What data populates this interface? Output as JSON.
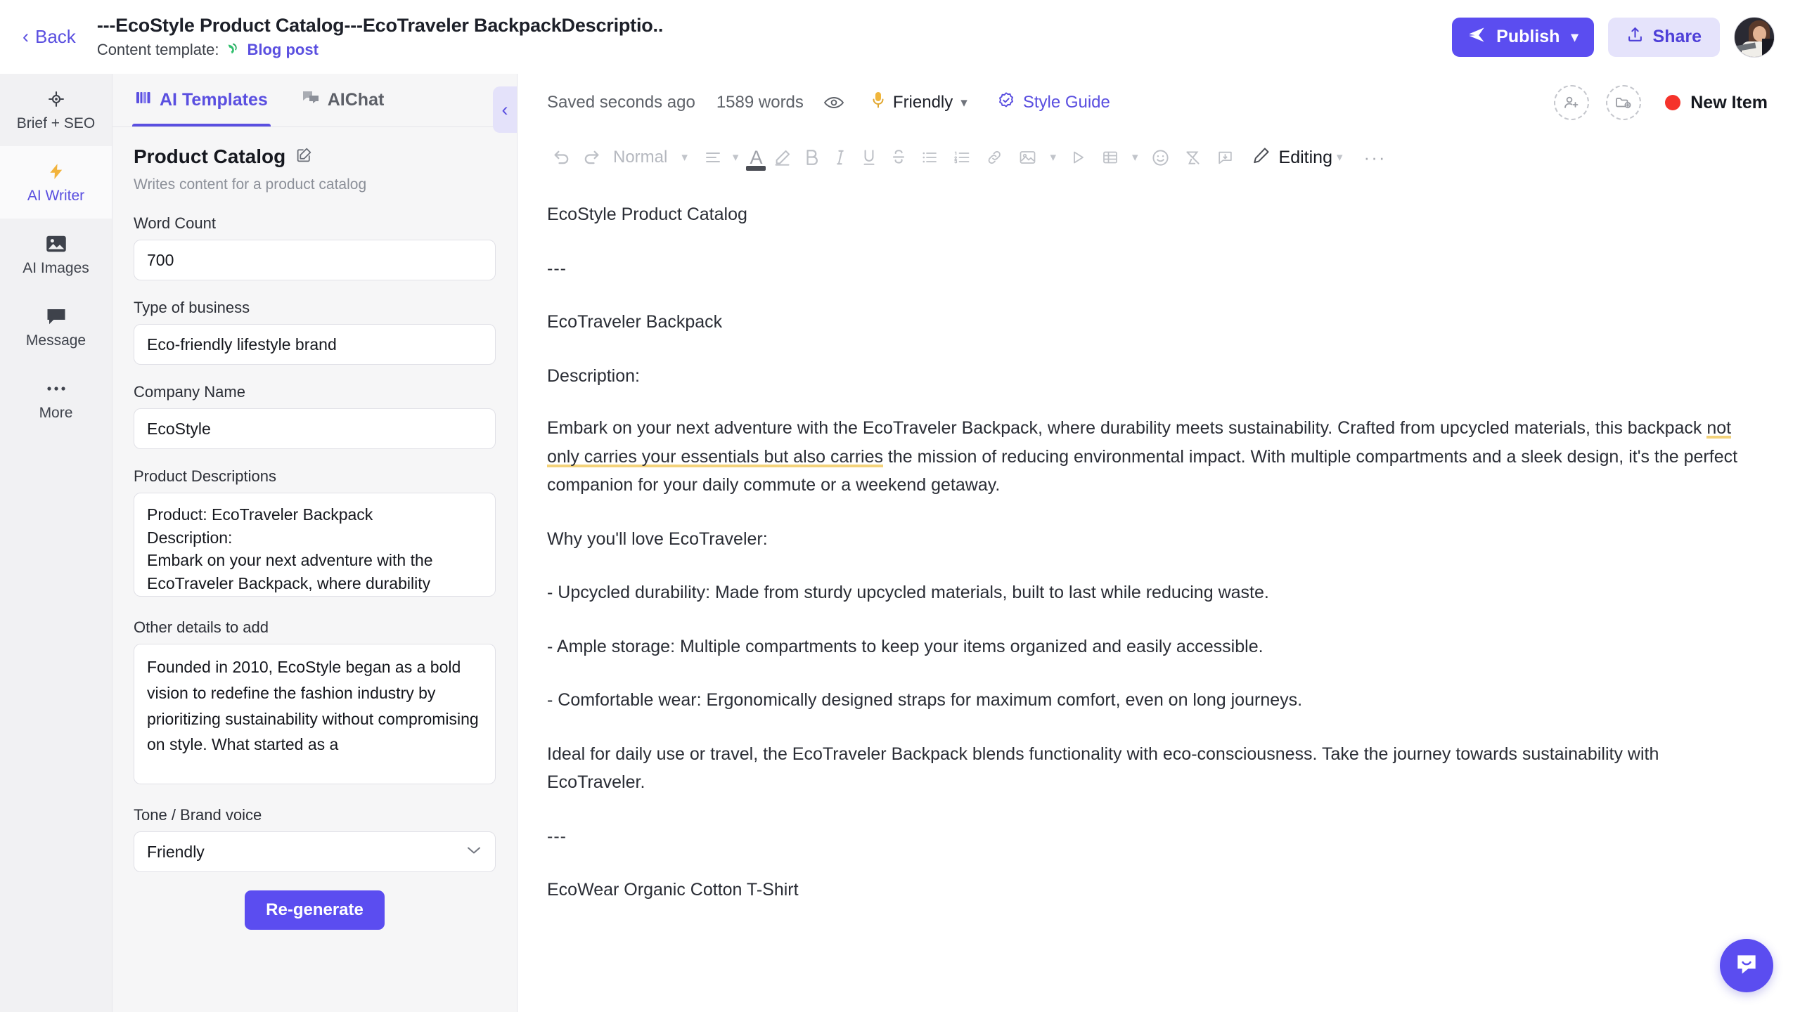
{
  "header": {
    "back_label": "Back",
    "doc_title": "---EcoStyle Product Catalog---EcoTraveler BackpackDescriptio..",
    "template_label": "Content template:",
    "template_link": "Blog post",
    "publish_label": "Publish",
    "share_label": "Share",
    "avatar_name": "user-avatar"
  },
  "rail": {
    "items": [
      {
        "label": "Brief + SEO",
        "icon": "target-icon",
        "active": false
      },
      {
        "label": "AI Writer",
        "icon": "lightning-icon",
        "active": true
      },
      {
        "label": "AI Images",
        "icon": "image-icon",
        "active": false
      },
      {
        "label": "Message",
        "icon": "chat-icon",
        "active": false
      },
      {
        "label": "More",
        "icon": "ellipsis-icon",
        "active": false
      }
    ]
  },
  "panel": {
    "tabs": [
      {
        "label": "AI Templates",
        "icon": "templates-icon",
        "active": true
      },
      {
        "label": "AIChat",
        "icon": "chat-bubbles-icon",
        "active": false
      }
    ],
    "template_name": "Product Catalog",
    "template_desc": "Writes content for a product catalog",
    "fields": {
      "word_count": {
        "label": "Word Count",
        "value": "700"
      },
      "type_of_business": {
        "label": "Type of business",
        "value": "Eco-friendly lifestyle brand"
      },
      "company_name": {
        "label": "Company Name",
        "value": "EcoStyle"
      },
      "product_descriptions": {
        "label": "Product Descriptions",
        "value": "Product: EcoTraveler Backpack\nDescription:\nEmbark on your next adventure with the EcoTraveler Backpack, where durability"
      },
      "other_details": {
        "label": "Other details to add",
        "value": "Founded in 2010, EcoStyle began as a bold vision to redefine the fashion industry by prioritizing sustainability without compromising on style. What started as a"
      },
      "tone": {
        "label": "Tone / Brand voice",
        "value": "Friendly"
      }
    },
    "regenerate_label": "Re-generate",
    "collapse_label": "collapse-panel"
  },
  "editor": {
    "status": {
      "saved": "Saved seconds ago",
      "words": "1589 words",
      "tone": "Friendly",
      "style_guide": "Style Guide",
      "new_item": "New Item"
    },
    "toolbar": {
      "block_format": "Normal",
      "editing_mode": "Editing"
    },
    "document": [
      {
        "type": "p",
        "text": "EcoStyle Product Catalog"
      },
      {
        "type": "p",
        "text": "---"
      },
      {
        "type": "p",
        "text": "EcoTraveler Backpack"
      },
      {
        "type": "p",
        "text": "Description:"
      },
      {
        "type": "p_highlight",
        "pre": "Embark on your next adventure with the EcoTraveler Backpack, where durability meets sustainability. Crafted from upcycled materials, this backpack ",
        "highlight": "not only carries your essentials but also carries",
        "post": " the mission of reducing environmental impact. With multiple compartments and a sleek design, it's the perfect companion for your daily commute or a weekend getaway."
      },
      {
        "type": "p",
        "text": "Why you'll love EcoTraveler:"
      },
      {
        "type": "p",
        "text": "- Upcycled durability: Made from sturdy upcycled materials, built to last while reducing waste."
      },
      {
        "type": "p",
        "text": "- Ample storage: Multiple compartments to keep your items organized and easily accessible."
      },
      {
        "type": "p",
        "text": "- Comfortable wear: Ergonomically designed straps for maximum comfort, even on long journeys."
      },
      {
        "type": "p",
        "text": "Ideal for daily use or travel, the EcoTraveler Backpack blends functionality with eco-consciousness. Take the journey towards sustainability with EcoTraveler."
      },
      {
        "type": "p",
        "text": "---"
      },
      {
        "type": "p",
        "text": "EcoWear Organic Cotton T-Shirt"
      }
    ]
  },
  "colors": {
    "accent": "#5b4df0",
    "accent_text": "#5a4fe0",
    "share_bg": "#e5e3fb",
    "highlight_underline": "#f3d27a",
    "status_dot": "#f5332b"
  }
}
